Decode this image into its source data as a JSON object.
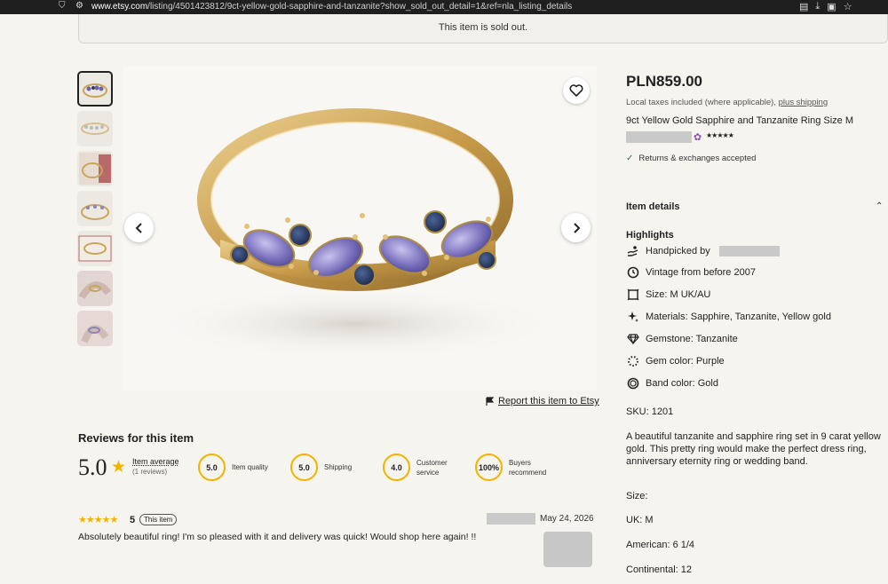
{
  "browser": {
    "url_host": "www.etsy.com",
    "url_path": "/listing/4501423812/9ct-yellow-gold-sapphire-and-tanzanite?show_sold_out_detail=1&ref=nla_listing_details"
  },
  "banner": {
    "text": "This item is sold out."
  },
  "gallery": {
    "thumbnails": [
      "ring-front",
      "ring-top",
      "ring-box",
      "ring-side",
      "ring-box-2",
      "ring-hand",
      "ring-hand-2"
    ],
    "report_label": "Report this item to Etsy",
    "icons": {
      "favorite": "heart-icon",
      "prev": "chevron-left-icon",
      "next": "chevron-right-icon",
      "report": "flag-icon"
    }
  },
  "reviews": {
    "title": "Reviews for this item",
    "average": "5.0",
    "average_label": "Item average",
    "count_label": "(1 reviews)",
    "metrics": [
      {
        "value": "5.0",
        "label": "Item quality"
      },
      {
        "value": "5.0",
        "label": "Shipping"
      },
      {
        "value": "4.0",
        "label": "Customer service"
      },
      {
        "value": "100%",
        "label": "Buyers recommend"
      }
    ],
    "items": [
      {
        "stars": "★★★★★",
        "rating": "5",
        "tag": "This item",
        "date": "May 24, 2026",
        "text": "Absolutely beautiful ring! I'm so pleased with it and delivery was quick! Would shop here again! !!"
      }
    ]
  },
  "product": {
    "price": "PLN859.00",
    "taxes_text": "Local taxes included (where applicable),",
    "taxes_link": "plus shipping",
    "title": "9ct Yellow Gold Sapphire and Tanzanite Ring Size M",
    "seller_stars": "★★★★★",
    "returns": "Returns & exchanges accepted"
  },
  "details": {
    "heading": "Item details",
    "highlights_heading": "Highlights",
    "highlights": [
      {
        "icon": "hand-icon",
        "text": "Handpicked by"
      },
      {
        "icon": "clock-icon",
        "text": "Vintage from before 2007"
      },
      {
        "icon": "size-icon",
        "text": "Size: M UK/AU"
      },
      {
        "icon": "sparkle-icon",
        "text": "Materials: Sapphire, Tanzanite, Yellow gold"
      },
      {
        "icon": "gem-icon",
        "text": "Gemstone: Tanzanite"
      },
      {
        "icon": "dotted-circle-icon",
        "text": "Gem color: Purple"
      },
      {
        "icon": "ring-icon",
        "text": "Band color: Gold"
      }
    ],
    "sku": "SKU: 1201",
    "description": "A beautiful tanzanite and sapphire ring set in 9 carat yellow gold. This pretty ring would make the perfect dress ring, anniversary eternity ring or wedding band.",
    "specs": [
      "Size:",
      "UK: M",
      "American: 6 1/4",
      "Continental: 12"
    ]
  }
}
